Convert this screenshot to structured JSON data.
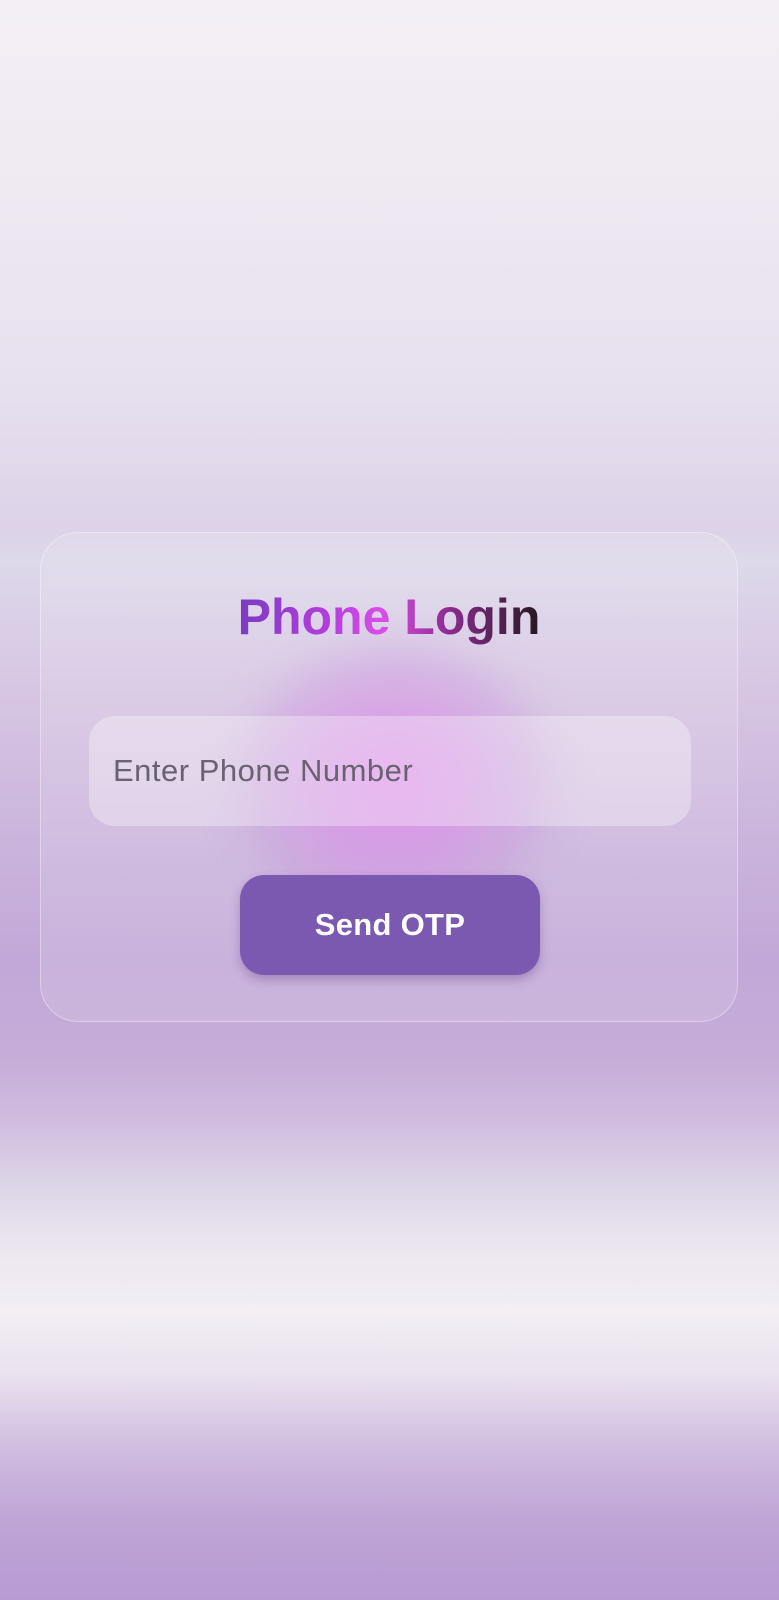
{
  "login": {
    "title": "Phone Login",
    "phone_placeholder": "Enter Phone Number",
    "phone_value": "",
    "send_button_label": "Send OTP"
  },
  "colors": {
    "button_bg": "#7b59b1",
    "title_gradient_start": "#7a3cc2",
    "title_gradient_mid": "#da4ee9",
    "title_gradient_end": "#261821",
    "background_top": "#f3eff5",
    "background_bottom": "#b79bd2"
  }
}
